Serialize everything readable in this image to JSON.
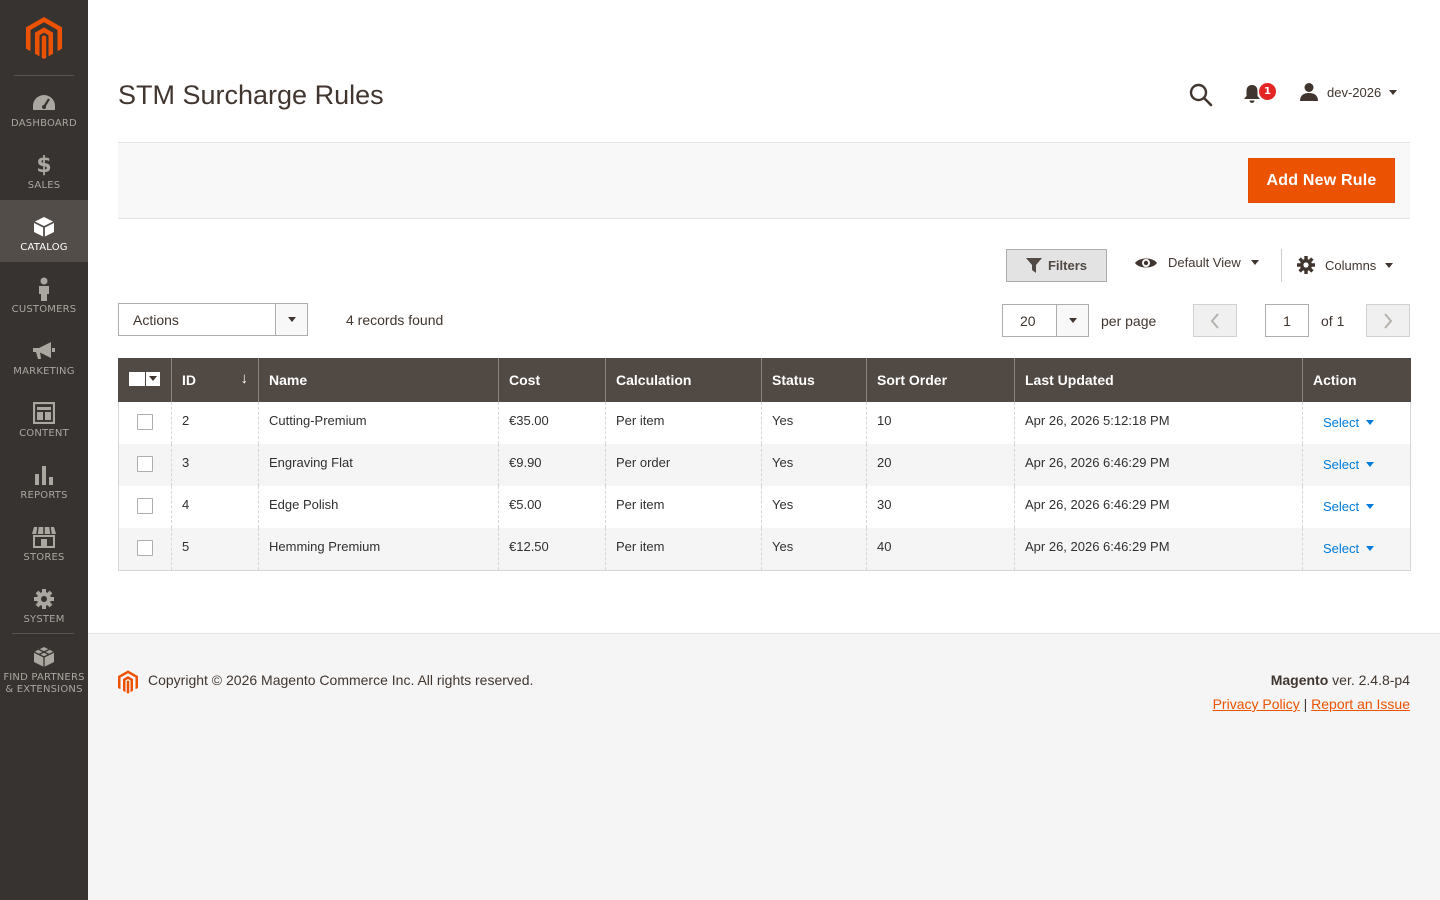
{
  "sidebar": {
    "logo_icon": "magento-logo-icon",
    "items": [
      {
        "label": "DASHBOARD",
        "icon": "dashboard-icon"
      },
      {
        "label": "SALES",
        "icon": "dollar-icon"
      },
      {
        "label": "CATALOG",
        "icon": "box-icon",
        "active": true
      },
      {
        "label": "CUSTOMERS",
        "icon": "person-icon"
      },
      {
        "label": "MARKETING",
        "icon": "megaphone-icon"
      },
      {
        "label": "CONTENT",
        "icon": "layout-icon"
      },
      {
        "label": "REPORTS",
        "icon": "bar-chart-icon"
      },
      {
        "label": "STORES",
        "icon": "store-icon"
      },
      {
        "label": "SYSTEM",
        "icon": "gear-icon"
      },
      {
        "label": "FIND PARTNERS\n& EXTENSIONS",
        "label_line1": "FIND PARTNERS",
        "label_line2": "& EXTENSIONS",
        "icon": "cubes-icon"
      }
    ]
  },
  "header": {
    "title": "STM Surcharge Rules",
    "notifications_count": "1",
    "user_name": "dev-2026"
  },
  "action_bar": {
    "add_button_label": "Add New Rule"
  },
  "toolbar": {
    "filters_label": "Filters",
    "view_label": "Default View",
    "columns_label": "Columns",
    "actions_label": "Actions",
    "records_found": "4 records found",
    "per_page_value": "20",
    "per_page_label": "per page",
    "current_page": "1",
    "of_pages": "of 1"
  },
  "grid": {
    "columns": [
      "ID",
      "Name",
      "Cost",
      "Calculation",
      "Status",
      "Sort Order",
      "Last Updated",
      "Action"
    ],
    "rows": [
      {
        "id": "2",
        "name": "Cutting-Premium",
        "cost": "€35.00",
        "calculation": "Per item",
        "status": "Yes",
        "sort_order": "10",
        "last_updated": "Apr 26, 2026 5:12:18 PM",
        "action": "Select"
      },
      {
        "id": "3",
        "name": "Engraving Flat",
        "cost": "€9.90",
        "calculation": "Per order",
        "status": "Yes",
        "sort_order": "20",
        "last_updated": "Apr 26, 2026 6:46:29 PM",
        "action": "Select"
      },
      {
        "id": "4",
        "name": "Edge Polish",
        "cost": "€5.00",
        "calculation": "Per item",
        "status": "Yes",
        "sort_order": "30",
        "last_updated": "Apr 26, 2026 6:46:29 PM",
        "action": "Select"
      },
      {
        "id": "5",
        "name": "Hemming Premium",
        "cost": "€12.50",
        "calculation": "Per item",
        "status": "Yes",
        "sort_order": "40",
        "last_updated": "Apr 26, 2026 6:46:29 PM",
        "action": "Select"
      }
    ]
  },
  "footer": {
    "copyright": "Copyright © 2026 Magento Commerce Inc. All rights reserved.",
    "brand": "Magento",
    "version": " ver. 2.4.8-p4",
    "privacy_label": "Privacy Policy",
    "separator": "|",
    "report_label": "Report an Issue"
  },
  "colors": {
    "sidebar_bg": "#373330",
    "accent": "#eb5202",
    "grid_header_bg": "#514943",
    "link": "#007bdb",
    "badge": "#e22626"
  }
}
